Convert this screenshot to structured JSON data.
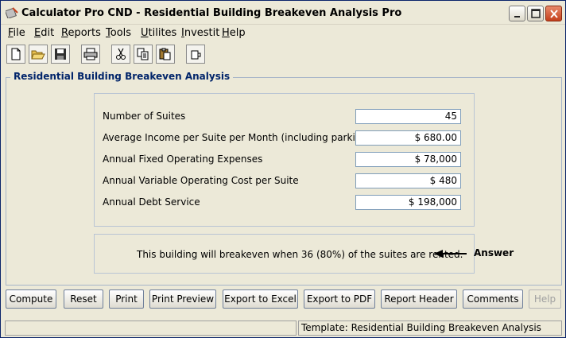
{
  "window": {
    "title": "Calculator Pro CND - Residential Building Breakeven Analysis Pro"
  },
  "menu": {
    "items": [
      {
        "mnemonic": "F",
        "rest": "ile"
      },
      {
        "mnemonic": "E",
        "rest": "dit"
      },
      {
        "mnemonic": "R",
        "rest": "eports"
      },
      {
        "mnemonic": "T",
        "rest": "ools"
      },
      {
        "mnemonic": "U",
        "rest": "tilites"
      },
      {
        "mnemonic": "I",
        "rest": "nvestit"
      },
      {
        "mnemonic": "H",
        "rest": "elp"
      }
    ]
  },
  "toolbar": {
    "icons": [
      "new-file-icon",
      "open-folder-icon",
      "save-icon",
      "print-icon",
      "cut-icon",
      "copy-icon",
      "paste-icon",
      "export-icon"
    ]
  },
  "panel": {
    "title": "Residential Building Breakeven Analysis"
  },
  "fields": [
    {
      "label": "Number of Suites",
      "value": "45"
    },
    {
      "label": "Average Income per Suite per Month (including parking)",
      "value": "$ 680.00"
    },
    {
      "label": "Annual Fixed Operating Expenses",
      "value": "$ 78,000"
    },
    {
      "label": "Annual Variable Operating Cost per Suite",
      "value": "$ 480"
    },
    {
      "label": "Annual Debt Service",
      "value": "$ 198,000"
    }
  ],
  "answer": {
    "text": "This building will breakeven when 36 (80%) of the suites are rented.",
    "label": "Answer"
  },
  "buttons": {
    "compute": "Compute",
    "reset": "Reset",
    "print": "Print",
    "print_preview": "Print Preview",
    "export_excel": "Export to Excel",
    "export_pdf": "Export to PDF",
    "report_header": "Report Header",
    "comments": "Comments",
    "help": "Help"
  },
  "status": {
    "left": "",
    "template": "Template: Residential Building Breakeven Analysis"
  }
}
